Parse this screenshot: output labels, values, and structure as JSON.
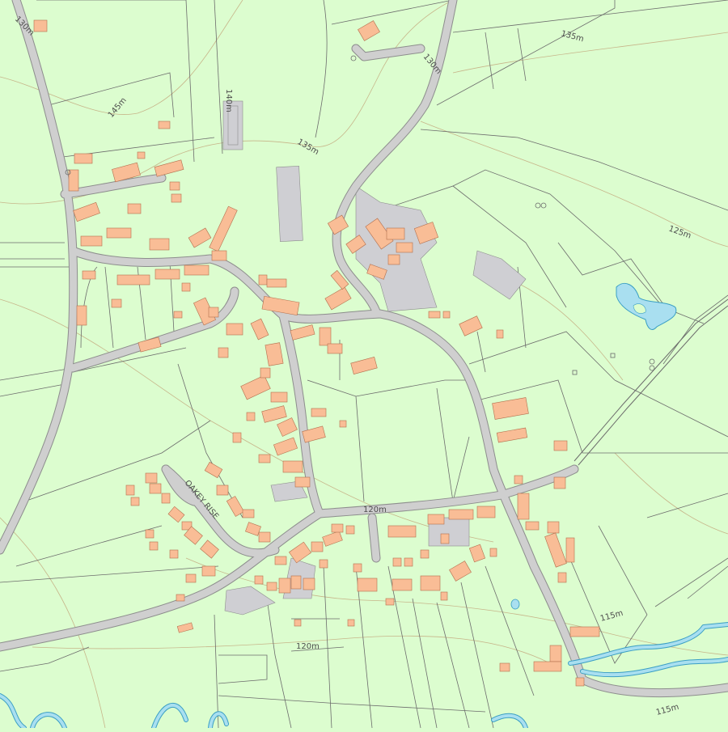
{
  "colors": {
    "land": "#dcfdcf",
    "road": "#cfcfcf",
    "building": "#f9bd96",
    "water": "#a9dff0",
    "water_edge": "#3b9fc4",
    "contour": "#c7b58a"
  },
  "contour_labels": {
    "c130_nw": "130m",
    "c145": "145m",
    "c140": "140m",
    "c135_mid": "135m",
    "c130_n": "130m",
    "c135_ne": "135m",
    "c125": "125m",
    "c120_road": "120m",
    "c120_s": "120m",
    "c115_e": "115m",
    "c115_se": "115m"
  },
  "street_names": {
    "oakey_rise": "OAKEY RISE"
  }
}
